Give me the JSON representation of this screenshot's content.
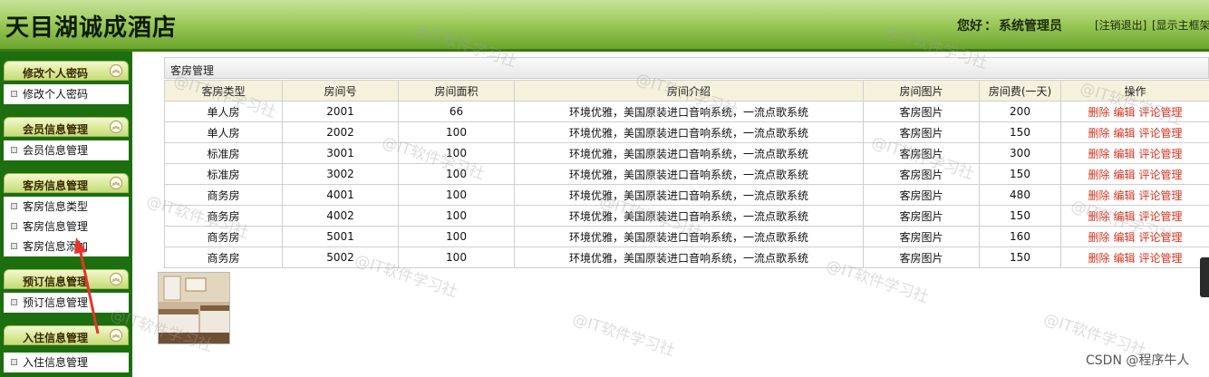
{
  "header": {
    "app_title": "天目湖诚成酒店",
    "greeting_label": "您好",
    "greeting_user": "系统管理员",
    "logout": "[注销退出]",
    "toggle_frame": "[显示主框架]"
  },
  "sidebar": {
    "groups": [
      {
        "title": "修改个人密码",
        "items": [
          "修改个人密码"
        ]
      },
      {
        "title": "会员信息管理",
        "items": [
          "会员信息管理"
        ]
      },
      {
        "title": "客房信息管理",
        "items": [
          "客房信息类型",
          "客房信息管理",
          "客房信息添加"
        ]
      },
      {
        "title": "预订信息管理",
        "items": [
          "预订信息管理"
        ]
      },
      {
        "title": "入住信息管理",
        "items": [
          "入住信息管理"
        ]
      }
    ]
  },
  "main": {
    "panel_title": "客房管理",
    "columns": [
      "客房类型",
      "房间号",
      "房间面积",
      "房间介绍",
      "房间图片",
      "房间费(一天)",
      "操作"
    ],
    "rows": [
      {
        "type": "单人房",
        "room": "2001",
        "area": "66",
        "intro": "环境优雅，美国原装进口音响系统，一流点歌系统",
        "image": "客房图片",
        "price": "200"
      },
      {
        "type": "单人房",
        "room": "2002",
        "area": "100",
        "intro": "环境优雅，美国原装进口音响系统，一流点歌系统",
        "image": "客房图片",
        "price": "150"
      },
      {
        "type": "标准房",
        "room": "3001",
        "area": "100",
        "intro": "环境优雅，美国原装进口音响系统，一流点歌系统",
        "image": "客房图片",
        "price": "300"
      },
      {
        "type": "标准房",
        "room": "3002",
        "area": "100",
        "intro": "环境优雅，美国原装进口音响系统，一流点歌系统",
        "image": "客房图片",
        "price": "150"
      },
      {
        "type": "商务房",
        "room": "4001",
        "area": "100",
        "intro": "环境优雅，美国原装进口音响系统，一流点歌系统",
        "image": "客房图片",
        "price": "480"
      },
      {
        "type": "商务房",
        "room": "4002",
        "area": "100",
        "intro": "环境优雅，美国原装进口音响系统，一流点歌系统",
        "image": "客房图片",
        "price": "150"
      },
      {
        "type": "商务房",
        "room": "5001",
        "area": "100",
        "intro": "环境优雅，美国原装进口音响系统，一流点歌系统",
        "image": "客房图片",
        "price": "160"
      },
      {
        "type": "商务房",
        "room": "5002",
        "area": "100",
        "intro": "环境优雅，美国原装进口音响系统，一流点歌系统",
        "image": "客房图片",
        "price": "150"
      }
    ],
    "actions": [
      "删除",
      "编辑",
      "评论管理"
    ]
  },
  "watermark": "@IT软件学习社",
  "credit": "CSDN @程序牛人",
  "colors": {
    "header_green": "#6aa52c",
    "sidebar_green": "#1c6e0f",
    "action_red": "#d9331f"
  },
  "icons": {
    "collapse": "collapse-up-icon",
    "bullet": "menu-bullet-icon",
    "annotation": "red-arrow-icon"
  }
}
